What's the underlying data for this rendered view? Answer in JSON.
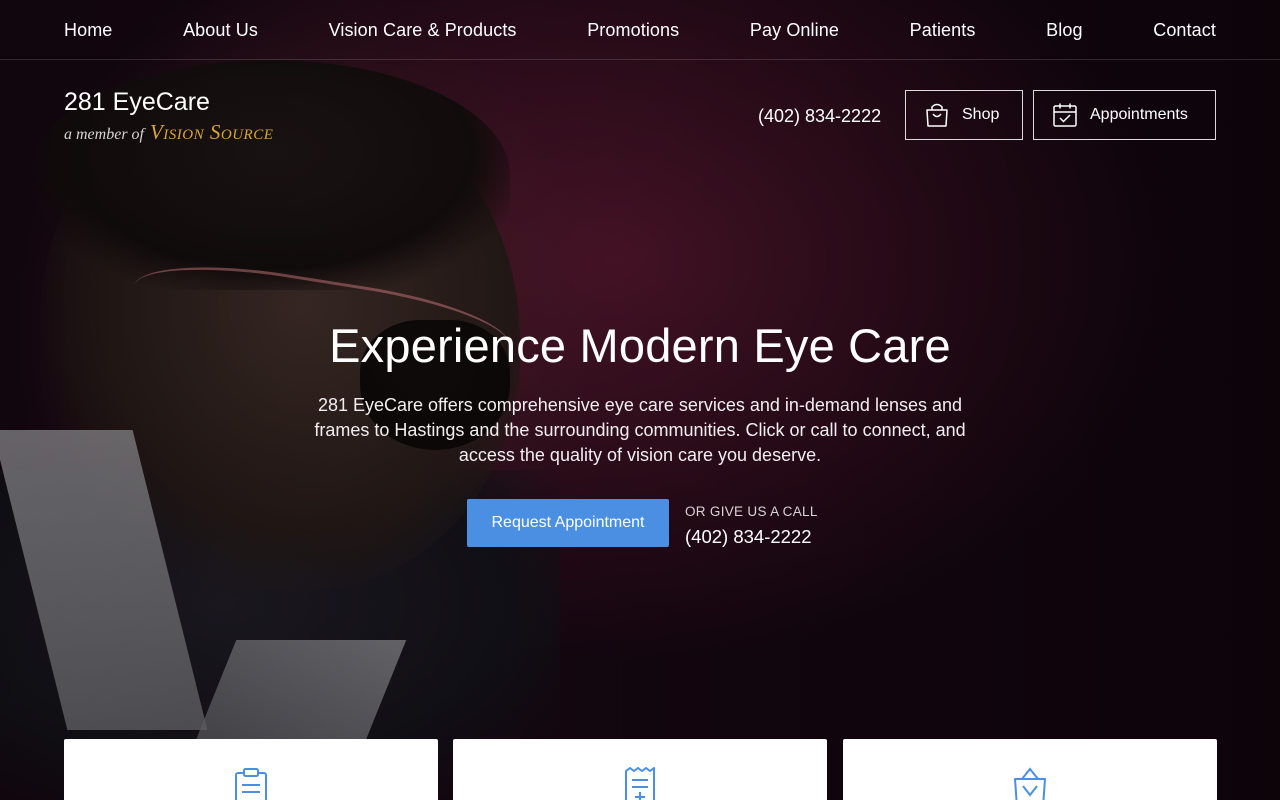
{
  "nav": {
    "items": [
      {
        "label": "Home"
      },
      {
        "label": "About Us"
      },
      {
        "label": "Vision Care & Products"
      },
      {
        "label": "Promotions"
      },
      {
        "label": "Pay Online"
      },
      {
        "label": "Patients"
      },
      {
        "label": "Blog"
      },
      {
        "label": "Contact"
      }
    ]
  },
  "brand": {
    "name": "281 EyeCare",
    "member_of": "a member of",
    "network": "Vision Source"
  },
  "header": {
    "phone": "(402) 834-2222",
    "shop_label": "Shop",
    "appointments_label": "Appointments",
    "shop_icon": "shopping-bag-icon",
    "appointments_icon": "calendar-check-icon"
  },
  "hero": {
    "title": "Experience Modern Eye Care",
    "text": "281 EyeCare offers comprehensive eye care services and in-demand lenses and frames to Hastings and the surrounding communities. Click or call to connect, and access the quality of vision care you deserve.",
    "cta_label": "Request Appointment",
    "call_label": "OR GIVE US A CALL",
    "call_phone": "(402) 834-2222"
  },
  "cards": [
    {
      "icon": "clipboard-icon"
    },
    {
      "icon": "receipt-icon"
    },
    {
      "icon": "shopping-bag-icon"
    }
  ],
  "colors": {
    "accent": "#4a8fe2",
    "brand_gold": "#d8a532",
    "icon_blue": "#4a8fe2"
  }
}
